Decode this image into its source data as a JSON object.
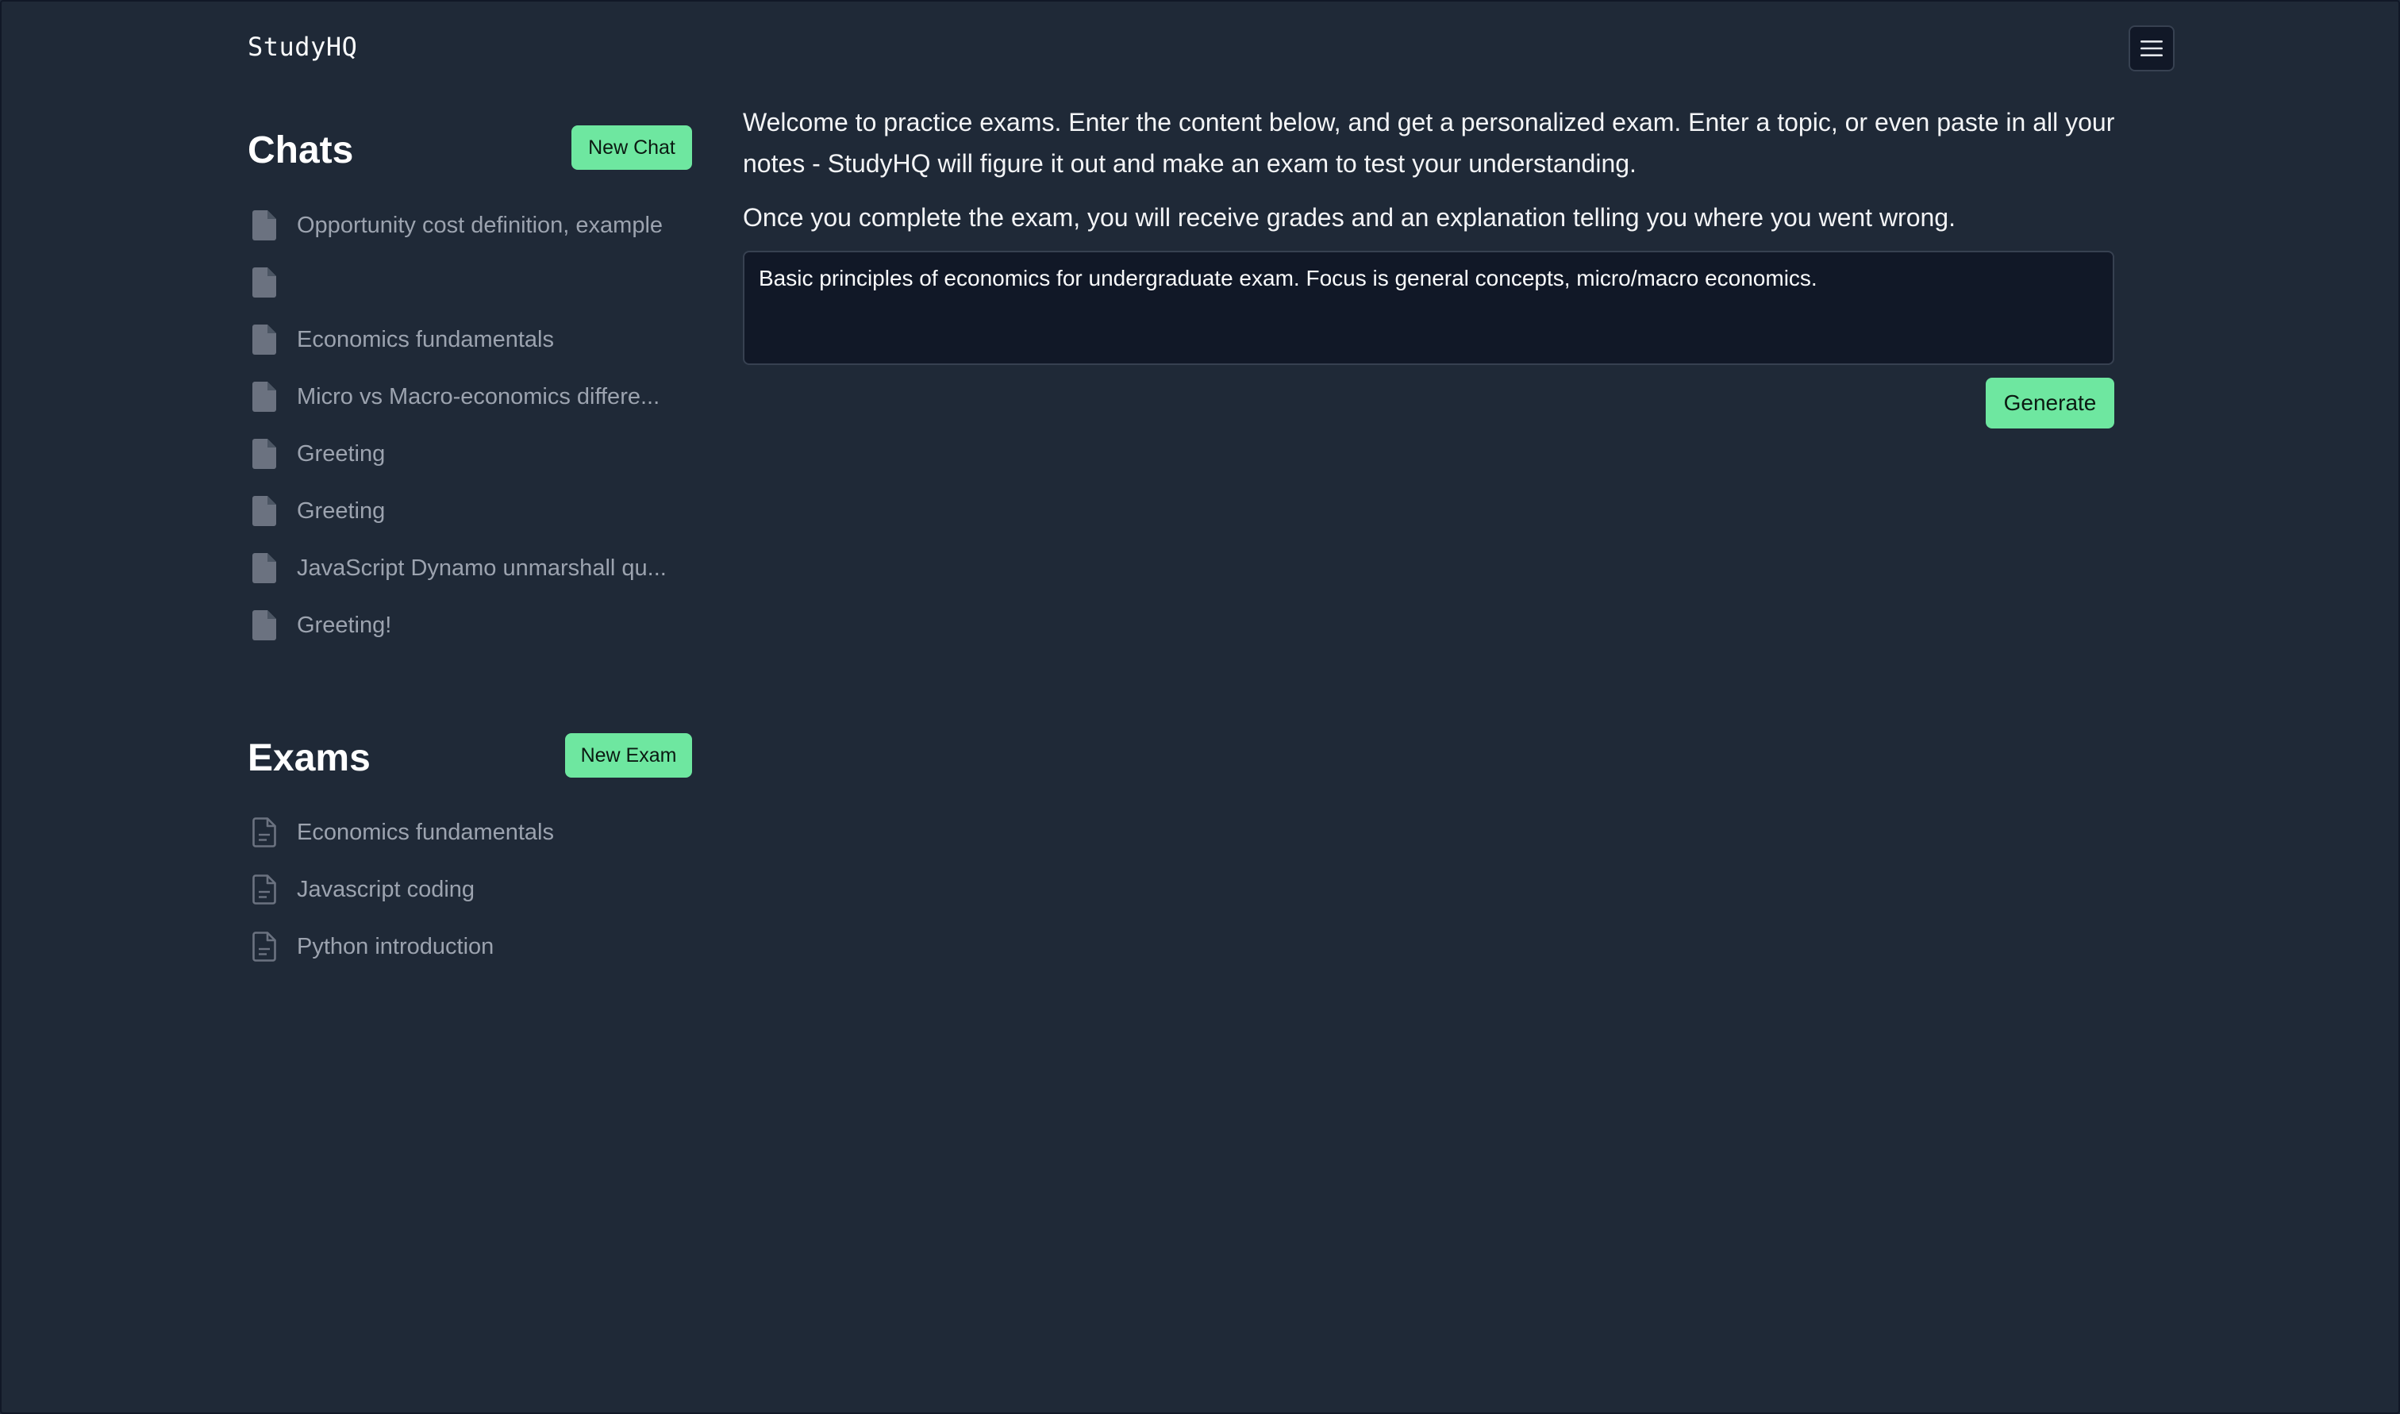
{
  "header": {
    "brand": "StudyHQ",
    "menu_icon": "hamburger-menu-icon"
  },
  "sidebar": {
    "chats": {
      "title": "Chats",
      "new_button_label": "New Chat",
      "items": [
        {
          "label": "Opportunity cost definition, example",
          "icon": "file-icon"
        },
        {
          "label": "",
          "icon": "file-icon"
        },
        {
          "label": "Economics fundamentals",
          "icon": "file-icon"
        },
        {
          "label": "Micro vs Macro-economics differe...",
          "icon": "file-icon"
        },
        {
          "label": "Greeting",
          "icon": "file-icon"
        },
        {
          "label": "Greeting",
          "icon": "file-icon"
        },
        {
          "label": "JavaScript Dynamo unmarshall qu...",
          "icon": "file-icon"
        },
        {
          "label": "Greeting!",
          "icon": "file-icon"
        }
      ]
    },
    "exams": {
      "title": "Exams",
      "new_button_label": "New Exam",
      "items": [
        {
          "label": "Economics fundamentals",
          "icon": "file-text-icon"
        },
        {
          "label": "Javascript coding",
          "icon": "file-text-icon"
        },
        {
          "label": "Python introduction",
          "icon": "file-text-icon"
        }
      ]
    }
  },
  "main": {
    "intro_paragraph_1": "Welcome to practice exams. Enter the content below, and get a personalized exam. Enter a topic, or even paste in all your notes - StudyHQ will figure it out and make an exam to test your understanding.",
    "intro_paragraph_2": "Once you complete the exam, you will receive grades and an explanation telling you where you went wrong.",
    "prompt_value": "Basic principles of economics for undergraduate exam. Focus is general concepts, micro/macro economics.",
    "generate_label": "Generate"
  },
  "colors": {
    "background": "#1f2937",
    "accent_green": "#6ee7a0",
    "muted_text": "#9ca3af",
    "input_background": "#111827"
  }
}
